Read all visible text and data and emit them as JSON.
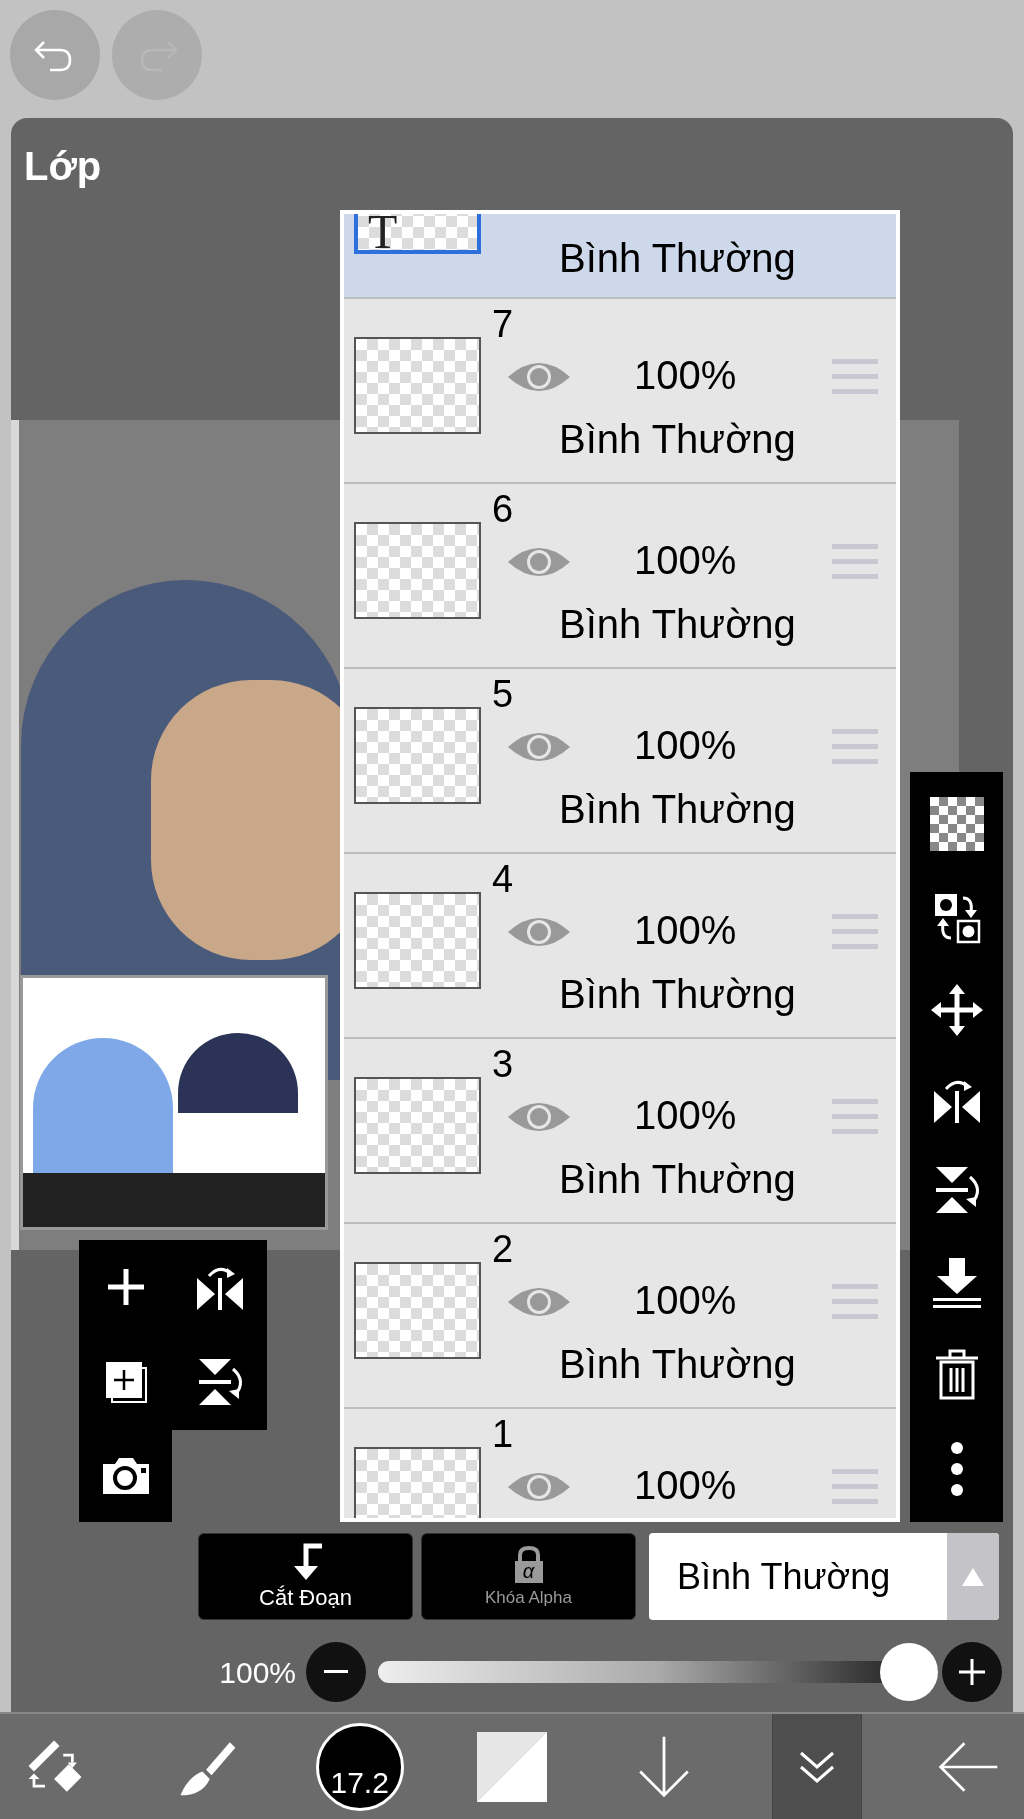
{
  "top_bar": {
    "undo": {
      "disabled": false
    },
    "redo": {
      "disabled": true
    }
  },
  "panel": {
    "title": "Lớp"
  },
  "layers": [
    {
      "selected": true,
      "thumbnail_text": "T",
      "mode": "Bình Thường"
    },
    {
      "number": "7",
      "selected": false,
      "visible": true,
      "opacity": "100%",
      "mode": "Bình Thường"
    },
    {
      "number": "6",
      "selected": false,
      "visible": true,
      "opacity": "100%",
      "mode": "Bình Thường"
    },
    {
      "number": "5",
      "selected": false,
      "visible": true,
      "opacity": "100%",
      "mode": "Bình Thường"
    },
    {
      "number": "4",
      "selected": false,
      "visible": true,
      "opacity": "100%",
      "mode": "Bình Thường"
    },
    {
      "number": "3",
      "selected": false,
      "visible": true,
      "opacity": "100%",
      "mode": "Bình Thường"
    },
    {
      "number": "2",
      "selected": false,
      "visible": true,
      "opacity": "100%",
      "mode": "Bình Thường"
    },
    {
      "number": "1",
      "selected": false,
      "visible": true,
      "opacity": "100%"
    }
  ],
  "buttons": [
    {
      "kind": "clipping",
      "label": "Cắt Đoạn",
      "disabled": false
    },
    {
      "kind": "alpha-lock",
      "glyph": "α",
      "label": "Khóa Alpha",
      "disabled": true
    }
  ],
  "blend_mode": {
    "value": "Bình Thường"
  },
  "opacity": {
    "reading": "100%",
    "level": 1.0
  },
  "toolbar": [
    {
      "kind": "tool-switch",
      "selected": false
    },
    {
      "kind": "brush",
      "selected": false
    },
    {
      "kind": "brush-size",
      "label": "17.2",
      "selected": false
    },
    {
      "kind": "color",
      "selected": false
    },
    {
      "kind": "down",
      "selected": false
    },
    {
      "kind": "collapse",
      "selected": true
    },
    {
      "kind": "back",
      "selected": false
    }
  ]
}
